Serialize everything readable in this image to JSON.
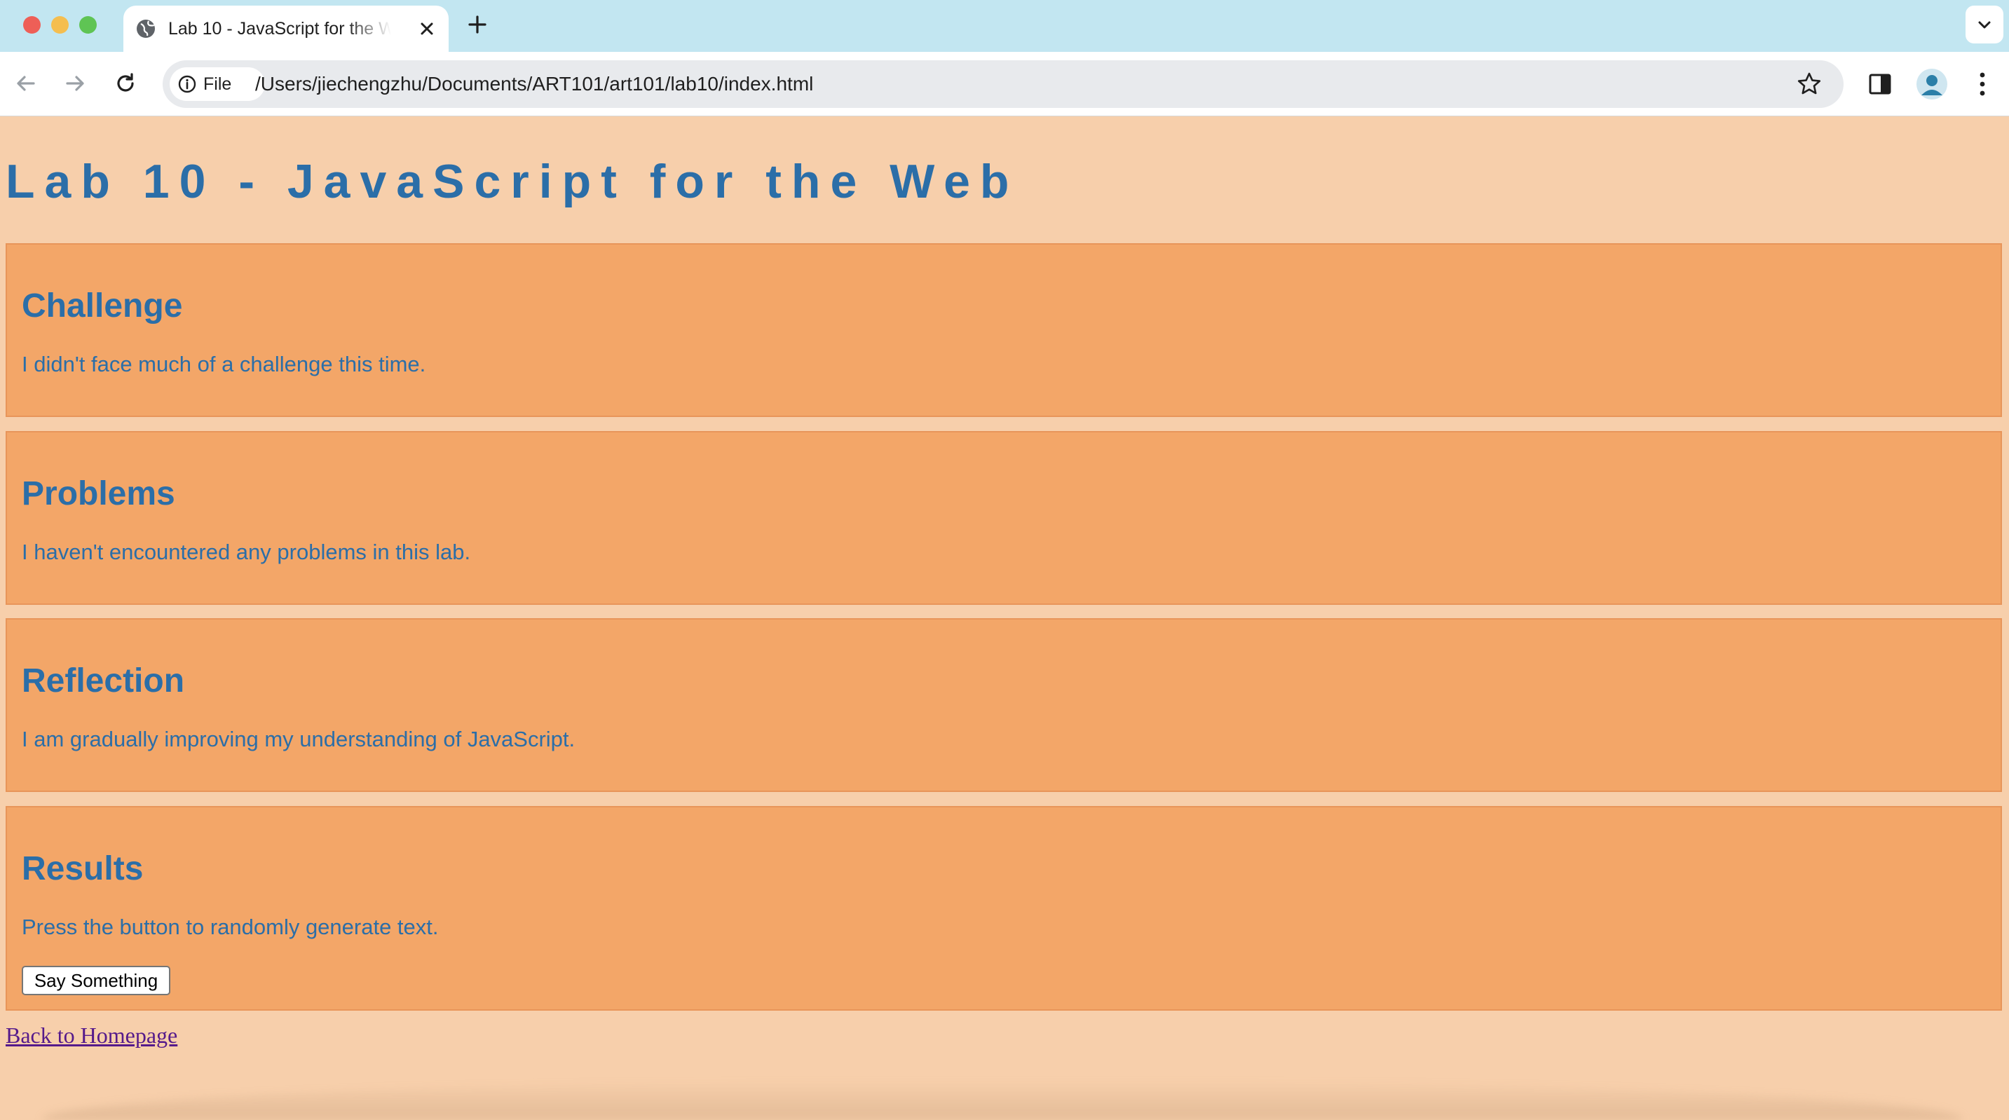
{
  "browser": {
    "tab": {
      "title": "Lab 10 - JavaScript for the Web"
    },
    "address_bar": {
      "chip_label": "File",
      "url": "/Users/jiechengzhu/Documents/ART101/art101/lab10/index.html"
    }
  },
  "page": {
    "title": "Lab 10 - JavaScript for the Web",
    "sections": [
      {
        "heading": "Challenge",
        "text": "I didn't face much of a challenge this time."
      },
      {
        "heading": "Problems",
        "text": "I haven't encountered any problems in this lab."
      },
      {
        "heading": "Reflection",
        "text": "I am gradually improving my understanding of JavaScript."
      },
      {
        "heading": "Results",
        "text": "Press the button to randomly generate text.",
        "button_label": "Say Something"
      }
    ],
    "back_link": "Back to Homepage"
  },
  "colors": {
    "page_background": "#f7cfab",
    "section_background": "#f3a668",
    "text_accent": "#2b6ea8",
    "link_visited": "#551a8b",
    "tab_strip": "#c2e6f1"
  }
}
